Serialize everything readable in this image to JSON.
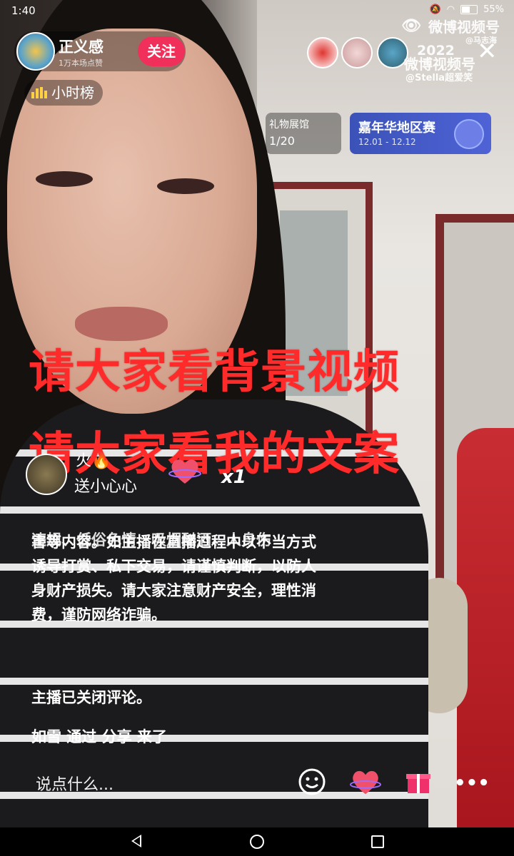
{
  "status_bar": {
    "time": "1:40",
    "battery": "55%"
  },
  "host": {
    "name": "正义感",
    "likes": "1万本场点赞",
    "follow_label": "关注"
  },
  "rank_label": "小时榜",
  "watermark": {
    "brand_primary": "微博视频号",
    "author_primary": "@马志海",
    "year": "2022",
    "brand_secondary": "微博视频号",
    "author_secondary": "@Stella超爱笑"
  },
  "gift_hall": {
    "title": "礼物展馆",
    "count": "1/20"
  },
  "carnival": {
    "title": "嘉年华地区赛",
    "dates": "12.01 - 12.12"
  },
  "caption": {
    "line1": "请大家看背景视频",
    "line2": "请大家看我的文案"
  },
  "gift_notice": {
    "sender": "火🔥",
    "action": "送小心心",
    "count": "x1"
  },
  "chat": {
    "notice_partial": "违规、低俗色情、吸烟酗酒、人身伤",
    "notice_body": "害等内容。如主播在直播过程中以不当方式诱导打赏、私下交易，请谨慎判断，以防人身财产损失。请大家注意财产安全，理性消费，谨防网络诈骗。",
    "comments_closed": "主播已关闭评论。",
    "join_message": "如雪 通过 分享 来了"
  },
  "bottom_bar": {
    "comment_placeholder": "说点什么..."
  },
  "colors": {
    "follow": "#f0305a",
    "caption": "#ff2b2b",
    "carnival": "#4f63d6"
  }
}
